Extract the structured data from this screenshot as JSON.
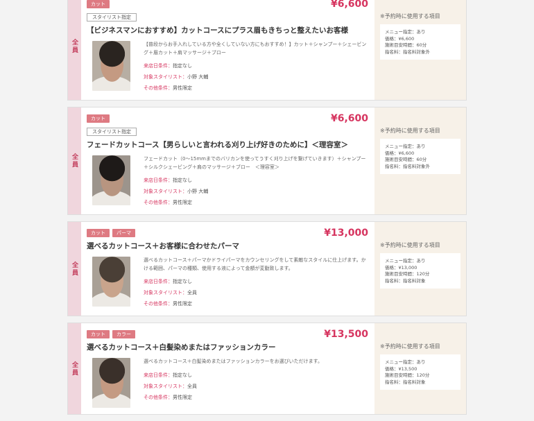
{
  "common": {
    "side_label": "全員",
    "stylist_tag": "スタイリスト指定",
    "cond_labels": {
      "visit": "来店日条件：",
      "stylist": "対象スタイリスト：",
      "other": "その他条件："
    },
    "right_title": "※予約時に使用する項目"
  },
  "coupons": [
    {
      "tags": [
        "カット"
      ],
      "price": "¥6,600",
      "show_stylist_tag": true,
      "title": "【ビジネスマンにおすすめ】カットコースにプラス眉もきちっと整えたいお客様",
      "desc": "【普段からお手入れしている方や全くしていない方にもおすすめ！】カット＋シャンプー＋シェービング＋眉カット＋肩マッサージ＋ブロー",
      "visit": "指定なし",
      "stylist": "小野 大輔",
      "other": "男性限定",
      "right_lines": [
        "メニュー指定：あり",
        "価格：¥6,600",
        "施術目安時間：60分",
        "指名料：指名料対象外"
      ],
      "photo": {
        "hair": "#2a2420",
        "bg": "#b7aea3",
        "skin": "#c49a82"
      }
    },
    {
      "tags": [
        "カット"
      ],
      "price": "¥6,600",
      "show_stylist_tag": true,
      "title": "フェードカットコース【男らしいと言われる刈り上げ好きのために】＜理容室＞",
      "desc": "フェードカット（0〜15mmまでのバリカンを使ってうすく刈り上げを繋げていきます）＋シャンプー＋シルクシェービング＋肩のマッサージ＋ブロー　＜理容室＞",
      "visit": "指定なし",
      "stylist": "小野 大輔",
      "other": "男性限定",
      "right_lines": [
        "メニュー指定：あり",
        "価格：¥6,600",
        "施術目安時間：60分",
        "指名料：指名料対象外"
      ],
      "photo": {
        "hair": "#1e1a18",
        "bg": "#9c948c",
        "skin": "#b89580"
      }
    },
    {
      "tags": [
        "カット",
        "パーマ"
      ],
      "price": "¥13,000",
      "show_stylist_tag": false,
      "title": "選べるカットコース＋お客様に合わせたパーマ",
      "desc": "選べるカットコース＋パーマかドライパーマをカウンセリングをして素敵なスタイルに仕上げます。かける範囲、パーマの種類、使用する液によって金額が変動致します。",
      "visit": "指定なし",
      "stylist": "全員",
      "other": "男性限定",
      "right_lines": [
        "メニュー指定：あり",
        "価格：¥13,000",
        "施術目安時間：120分",
        "指名料：指名料対象"
      ],
      "photo": {
        "hair": "#4a3f36",
        "bg": "#a9a096",
        "skin": "#c9a48c"
      }
    },
    {
      "tags": [
        "カット",
        "カラー"
      ],
      "price": "¥13,500",
      "show_stylist_tag": false,
      "title": "選べるカットコース＋白髪染めまたはファッションカラー",
      "desc": "選べるカットコース＋白髪染めまたはファッションカラーをお選びいただけます。",
      "visit": "指定なし",
      "stylist": "全員",
      "other": "男性限定",
      "right_lines": [
        "メニュー指定：あり",
        "価格：¥13,500",
        "施術目安時間：120分",
        "指名料：指名料対象"
      ],
      "photo": {
        "hair": "#3a302a",
        "bg": "#a59c92",
        "skin": "#c49a82"
      }
    }
  ]
}
